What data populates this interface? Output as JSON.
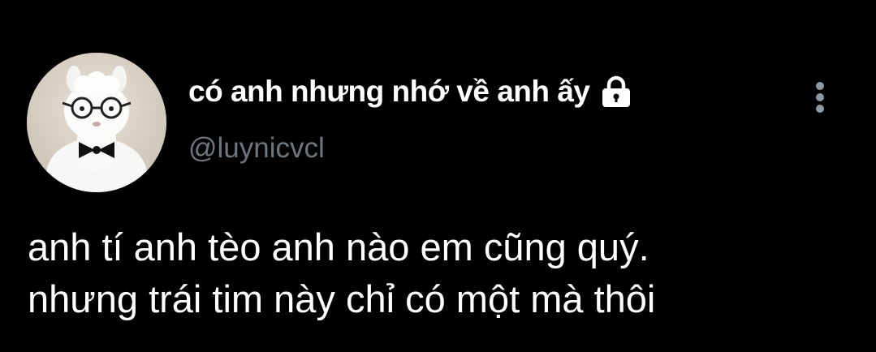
{
  "profile": {
    "display_name": "có anh nhưng nhớ về anh ấy",
    "handle": "@luynicvcl",
    "avatar_icon": "white-alpaca-plush-with-glasses-and-bowtie",
    "protected_icon": "lock-icon"
  },
  "tweet": {
    "lines": [
      "anh tí anh tèo anh nào em cũng quý.",
      "nhưng trái tim này chỉ có một mà thôi"
    ]
  },
  "menu": {
    "icon": "more-vertical-icon"
  },
  "colors": {
    "background": "#000000",
    "text": "#ffffff",
    "secondary_text": "#6e767d",
    "menu_dots": "#8b98a5"
  }
}
